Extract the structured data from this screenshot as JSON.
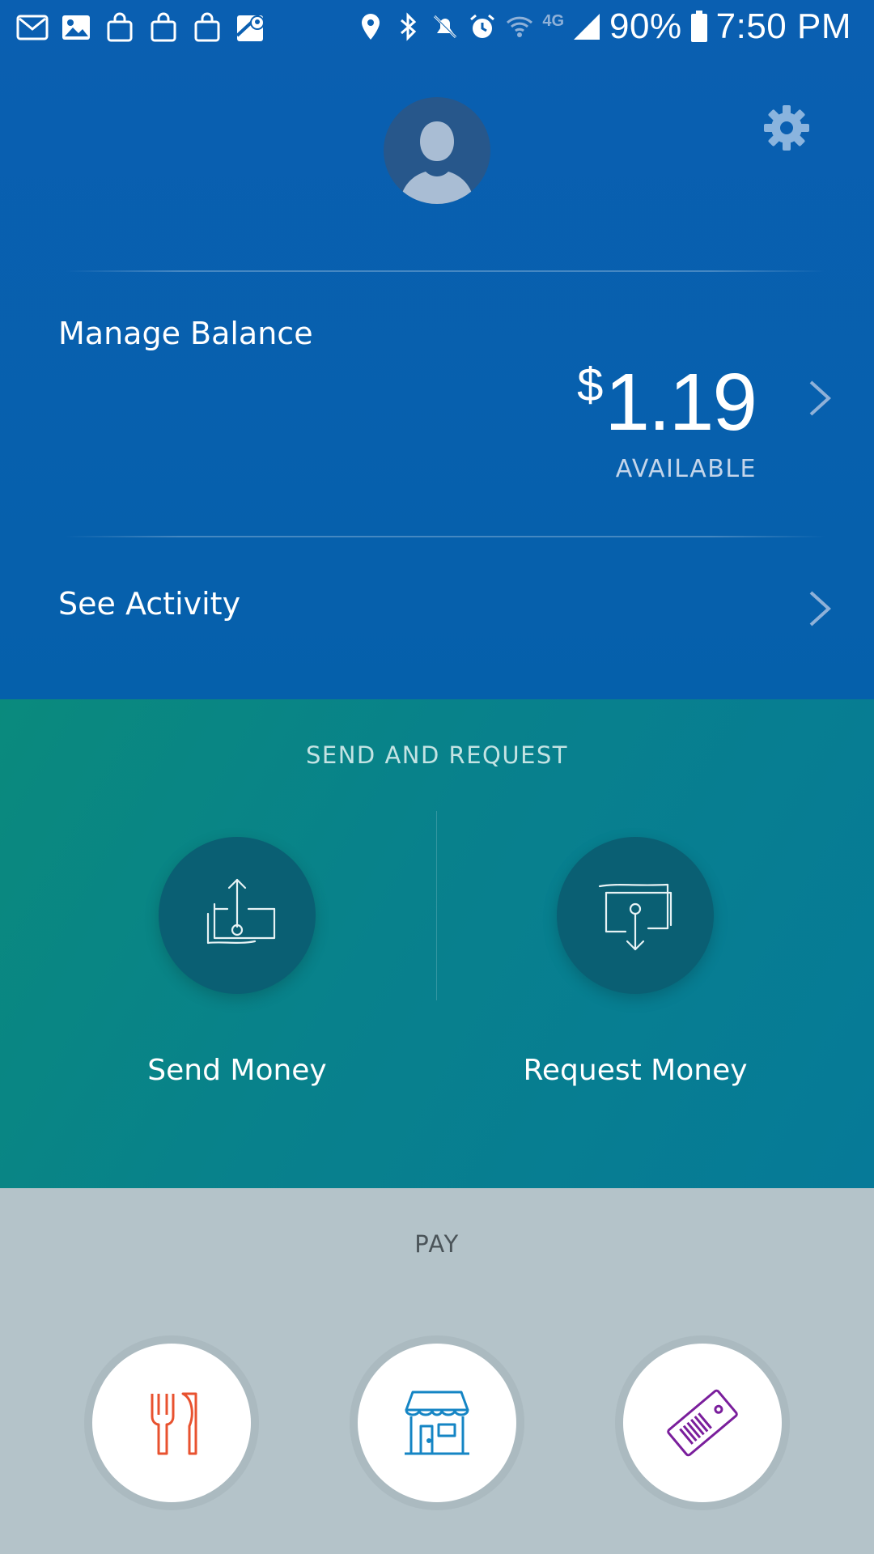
{
  "status_bar": {
    "battery": "90%",
    "time": "7:50 PM",
    "network": "4G",
    "left_icons": [
      "gmail-icon",
      "gallery-icon",
      "shopping-bag-icon",
      "shopping-bag-icon",
      "shopping-bag-icon",
      "maps-icon"
    ],
    "right_icons": [
      "location-icon",
      "bluetooth-icon",
      "mute-icon",
      "alarm-icon",
      "wifi-icon",
      "signal-icon",
      "battery-icon"
    ]
  },
  "header": {
    "avatar_icon": "user-avatar-icon",
    "settings_icon": "gear-icon"
  },
  "balance": {
    "label": "Manage Balance",
    "currency_symbol": "$",
    "amount": "1.19",
    "sublabel": "AVAILABLE"
  },
  "activity": {
    "label": "See Activity"
  },
  "send_request": {
    "title": "SEND AND REQUEST",
    "send_label": "Send Money",
    "request_label": "Request Money"
  },
  "pay": {
    "title": "PAY",
    "items": [
      {
        "icon": "restaurant-icon",
        "color": "#e8522f"
      },
      {
        "icon": "store-icon",
        "color": "#1585c4"
      },
      {
        "icon": "ticket-icon",
        "color": "#7a1e9c"
      }
    ]
  },
  "colors": {
    "header_blue": "#0560ab",
    "teal": "#08818c",
    "pay_bg": "#b4c3c9"
  }
}
